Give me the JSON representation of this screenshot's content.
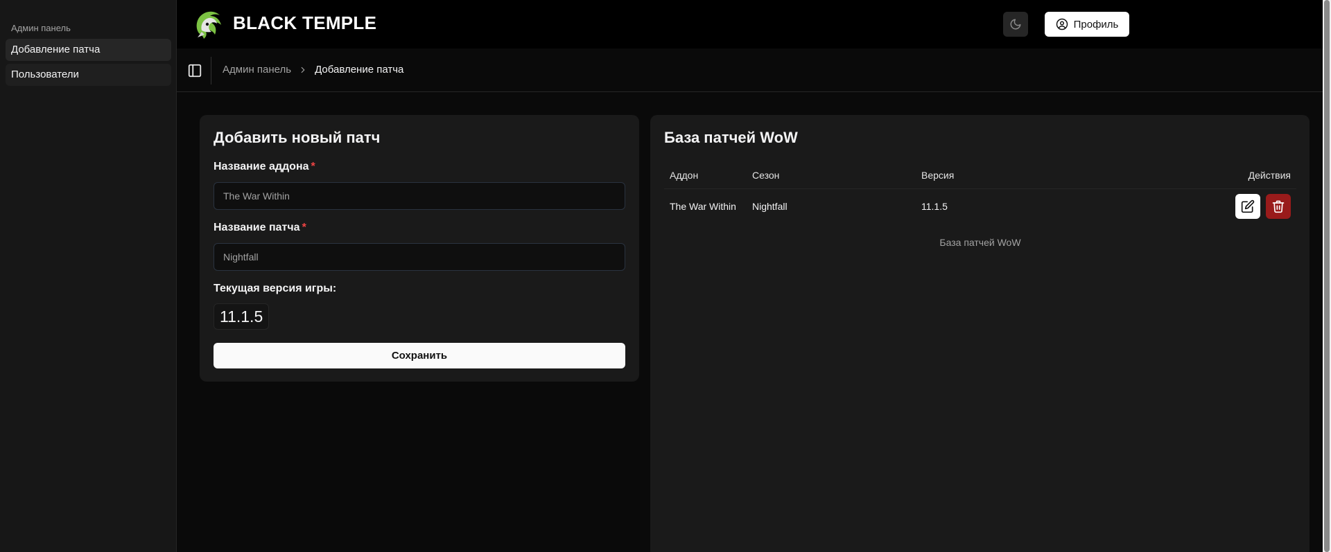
{
  "sidebar": {
    "group_label": "Админ панель",
    "items": [
      {
        "label": "Добавление патча"
      },
      {
        "label": "Пользователи"
      }
    ]
  },
  "header": {
    "brand": "BLACK TEMPLE",
    "profile_label": "Профиль"
  },
  "breadcrumb": {
    "parent": "Админ панель",
    "current": "Добавление патча"
  },
  "form": {
    "title": "Добавить новый патч",
    "addon_label": "Название аддона",
    "addon_value": "The War Within",
    "patch_label": "Название патча",
    "patch_value": "Nightfall",
    "required_mark": "*",
    "version_label": "Текущая версия игры:",
    "version_value": "11.1.5",
    "save_label": "Сохранить"
  },
  "patches": {
    "title": "База патчей WoW",
    "columns": {
      "addon": "Аддон",
      "season": "Сезон",
      "version": "Версия",
      "actions": "Действия"
    },
    "rows": [
      {
        "addon": "The War Within",
        "season": "Nightfall",
        "version": "11.1.5"
      }
    ],
    "caption": "База патчей WoW"
  },
  "colors": {
    "accent_green": "#7cc243",
    "delete_red": "#991b1b",
    "required_red": "#ef4444"
  }
}
